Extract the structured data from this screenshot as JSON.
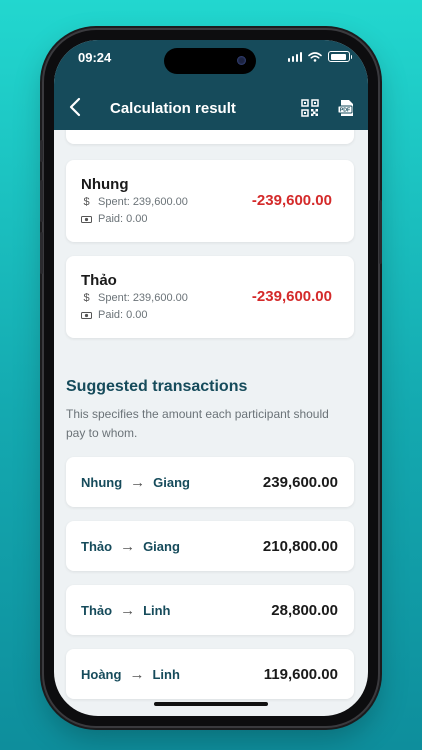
{
  "status_bar": {
    "time": "09:24"
  },
  "header": {
    "title": "Calculation result",
    "qr_icon": "qr-code-icon",
    "pdf_icon": "pdf-icon",
    "pdf_label": "PDF"
  },
  "participants": [
    {
      "name": "Nhung",
      "spent_label": "Spent:",
      "spent": "239,600.00",
      "paid_label": "Paid:",
      "paid": "0.00",
      "balance": "-239,600.00"
    },
    {
      "name": "Thảo",
      "spent_label": "Spent:",
      "spent": "239,600.00",
      "paid_label": "Paid:",
      "paid": "0.00",
      "balance": "-239,600.00"
    }
  ],
  "suggested": {
    "title": "Suggested transactions",
    "description": "This specifies the amount each participant should pay to whom.",
    "transactions": [
      {
        "from": "Nhung",
        "to": "Giang",
        "amount": "239,600.00"
      },
      {
        "from": "Thảo",
        "to": "Giang",
        "amount": "210,800.00"
      },
      {
        "from": "Thảo",
        "to": "Linh",
        "amount": "28,800.00"
      },
      {
        "from": "Hoàng",
        "to": "Linh",
        "amount": "119,600.00"
      }
    ]
  },
  "colors": {
    "header": "#164b5b",
    "negative": "#d42a2a",
    "background": "#eef2f4",
    "accent_text": "#164b5b"
  }
}
